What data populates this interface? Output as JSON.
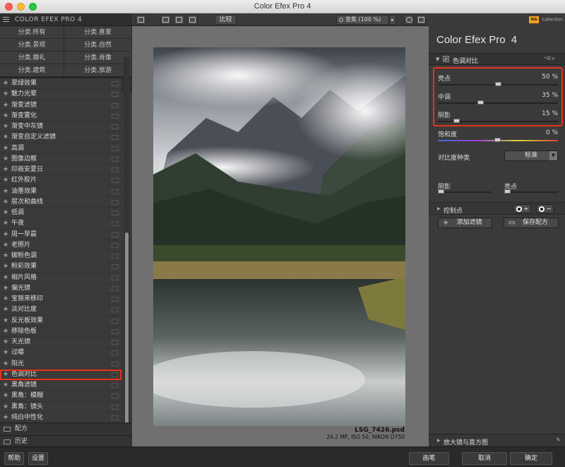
{
  "window": {
    "title": "Color Efex Pro 4"
  },
  "left_panel": {
    "brand": "COLOR EFEX PRO 4",
    "categories": [
      "分类.所有",
      "分类.喜爱",
      "分类.景观",
      "分类.自然",
      "分类.婚礼",
      "分类.肖像",
      "分类.建筑",
      "分类.旅游"
    ],
    "filters": [
      "翠绿效果",
      "魅力光晕",
      "渐变滤镜",
      "渐变雾化",
      "渐变中灰镜",
      "渐变自定义滤镜",
      "高调",
      "图像边框",
      "印画安夏日",
      "红外胶片",
      "油墨效果",
      "层次和曲线",
      "低调",
      "午夜",
      "周一早晨",
      "老照片",
      "碳粉色调",
      "粉彩效果",
      "相片风格",
      "偏光镜",
      "宝丽来移印",
      "淡对比度",
      "反光板效果",
      "移除色板",
      "天光镜",
      "过曝",
      "阳光",
      "色调对比",
      "黑角滤镜",
      "黑角：模糊",
      "黑角：镜头",
      "纯白中性化"
    ],
    "highlighted_filter": "色调对比",
    "footer_recipes": "配方",
    "footer_history": "历史"
  },
  "toolbar": {
    "compare_label": "比较",
    "zoom_label": "变焦 (100 %)"
  },
  "image": {
    "filename": "LSG_7426.psd",
    "info": "24.2 MP, ISO 50, NIKON D750"
  },
  "right_panel": {
    "logo_text": "Collection",
    "logo_box": "Nik",
    "app_name": "Color Efex Pro",
    "app_version": "4",
    "filter_name": "色调对比",
    "filter_options": "*☰×",
    "sliders": [
      {
        "label": "亮点",
        "value": "50 %",
        "level": 50
      },
      {
        "label": "中调",
        "value": "35 %",
        "level": 35
      },
      {
        "label": "阴影",
        "value": "15 %",
        "level": 15
      }
    ],
    "saturation": {
      "label": "饱和度",
      "value": "0 %",
      "level": 0
    },
    "contrast_type": {
      "label": "对比度种类",
      "value": "标准"
    },
    "shadow_label": "阴影",
    "highlight_label": "亮点",
    "control_points_label": "控制点",
    "add_filter_label": "添加滤镜",
    "save_recipe_label": "保存配方",
    "loupe_label": "放大镜与直方图"
  },
  "bottom_bar": {
    "help": "帮助",
    "settings": "设置",
    "brush": "画笔",
    "cancel": "取消",
    "ok": "确定"
  },
  "colors": {
    "highlight_red": "#e8331c",
    "panel_bg": "#3a3a3a",
    "canvas_bg": "#707070"
  }
}
